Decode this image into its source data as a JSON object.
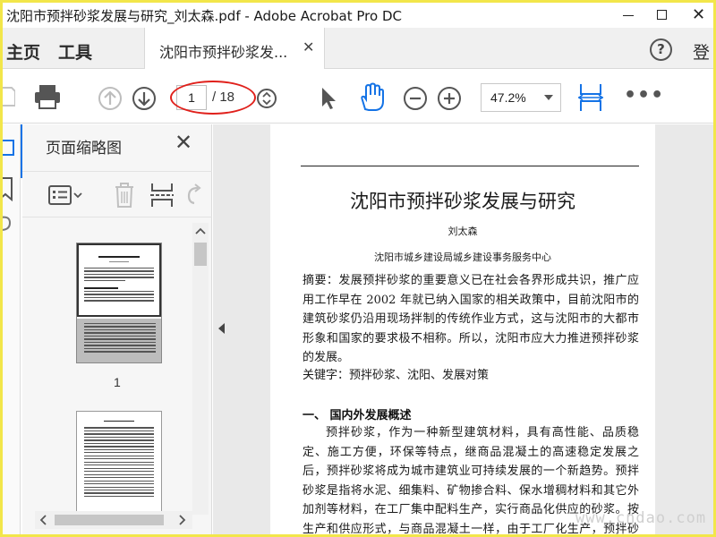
{
  "window": {
    "title": "沈阳市预拌砂浆发展与研究_刘太森.pdf - Adobe Acrobat Pro DC",
    "minimize": "—",
    "close": "✕"
  },
  "tabs": {
    "home": "主页",
    "tools": "工具",
    "document_tab": "沈阳市预拌砂浆发...",
    "document_tab_close": "✕",
    "help": "?",
    "login": "登"
  },
  "toolbar": {
    "current_page": "1",
    "page_total": "/ 18",
    "zoom": "47.2%",
    "more": "•••"
  },
  "panel": {
    "title": "页面缩略图",
    "close": "✕",
    "thumbnails": [
      {
        "page_number": "1"
      }
    ]
  },
  "document": {
    "title": "沈阳市预拌砂浆发展与研究",
    "author": "刘太森",
    "affiliation": "沈阳市城乡建设局城乡建设事务服务中心",
    "abstract": "摘要：发展预拌砂浆的重要意义已在社会各界形成共识，推广应用工作早在 2002 年就已纳入国家的相关政策中，目前沈阳市的建筑砂浆仍沿用现场拌制的传统作业方式，这与沈阳市的大都市形象和国家的要求极不相称。所以，沈阳市应大力推进预拌砂浆的发展。",
    "keywords": "关键字：预拌砂浆、沈阳、发展对策",
    "section_heading": "一、 国内外发展概述",
    "paragraph": "预拌砂浆，作为一种新型建筑材料，具有高性能、品质稳定、施工方便，环保等特点，继商品混凝土的高速稳定发展之后，预拌砂浆将成为城市建筑业可持续发展的一个新趋势。预拌砂浆是指将水泥、细集料、矿物掺合料、保水增稠材料和其它外加剂等材料，在工厂集中配料生产，实行商品化供应的砂浆。按生产和供应形式，与商品混凝土一样，由于工厂化生产，预拌砂浆质量"
  },
  "watermark": "www.cndao.com",
  "colors": {
    "annotation_ellipse": "#e0201b",
    "accent_blue": "#1473e6",
    "screenshot_border": "#f2e64a"
  }
}
